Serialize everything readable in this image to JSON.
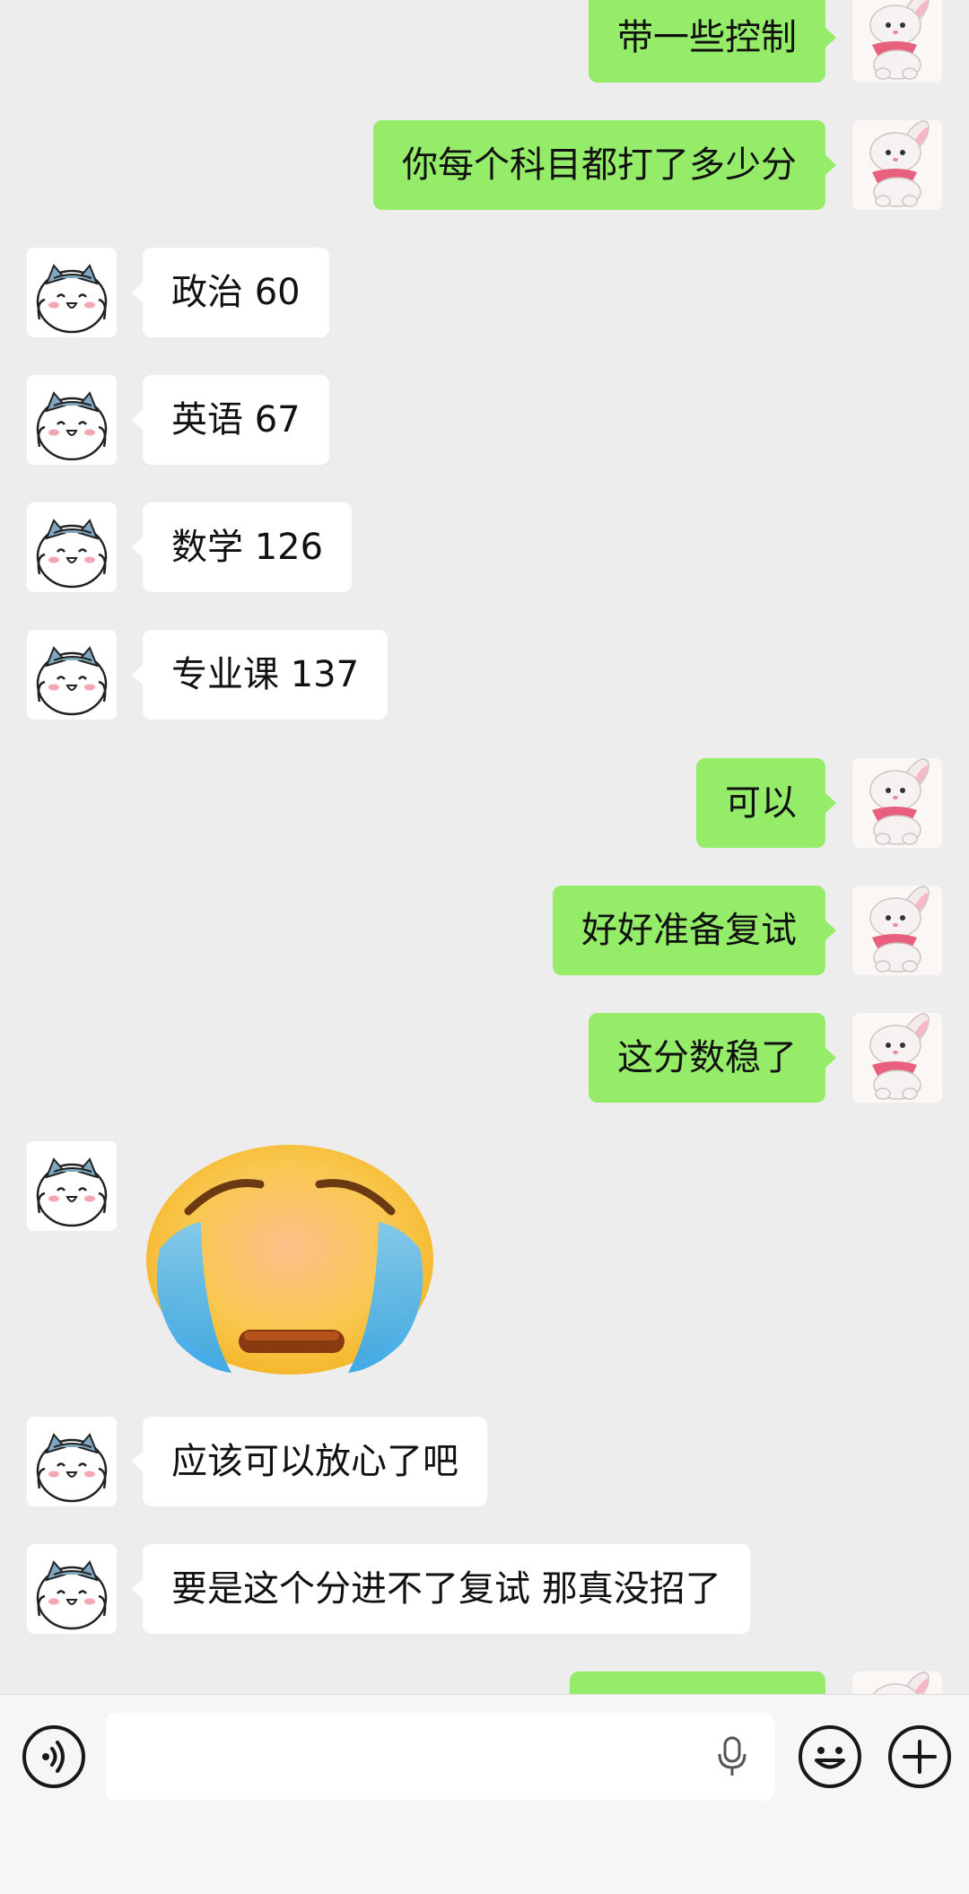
{
  "conversation": {
    "messages": [
      {
        "side": "right",
        "type": "text",
        "text": "带一些控制"
      },
      {
        "side": "right",
        "type": "text",
        "text": "你每个科目都打了多少分"
      },
      {
        "side": "left",
        "type": "text",
        "text": "政治 60"
      },
      {
        "side": "left",
        "type": "text",
        "text": "英语 67"
      },
      {
        "side": "left",
        "type": "text",
        "text": "数学 126"
      },
      {
        "side": "left",
        "type": "text",
        "text": "专业课 137"
      },
      {
        "side": "right",
        "type": "text",
        "text": "可以"
      },
      {
        "side": "right",
        "type": "text",
        "text": "好好准备复试"
      },
      {
        "side": "right",
        "type": "text",
        "text": "这分数稳了"
      },
      {
        "side": "left",
        "type": "sticker",
        "icon": "crying-face-sticker"
      },
      {
        "side": "left",
        "type": "text",
        "text": "应该可以放心了吧"
      },
      {
        "side": "left",
        "type": "text",
        "text": "要是这个分进不了复试 那真没招了"
      },
      {
        "side": "right",
        "type": "text",
        "text": ""
      }
    ]
  },
  "avatars": {
    "left_icon": "cat-girl-avatar",
    "right_icon": "pink-bunny-avatar"
  },
  "input_bar": {
    "voice_icon": "voice-mode-icon",
    "text_value": "",
    "mic_icon": "microphone-icon",
    "emoji_icon": "emoji-icon",
    "more_icon": "plus-icon"
  },
  "colors": {
    "background": "#ededed",
    "own_bubble": "#95ec69",
    "other_bubble": "#ffffff",
    "input_bar": "#f6f6f6"
  }
}
